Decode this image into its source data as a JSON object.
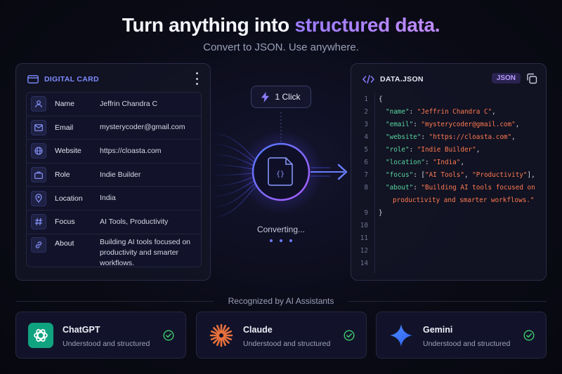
{
  "hero": {
    "title_plain": "Turn anything into ",
    "title_accent": "structured data.",
    "subtitle": "Convert to JSON. Use anywhere."
  },
  "card": {
    "header_label": "DIGITAL CARD",
    "fields": [
      {
        "icon": "user-icon",
        "label": "Name",
        "value": "Jeffrin Chandra C"
      },
      {
        "icon": "mail-icon",
        "label": "Email",
        "value": "mysterycoder@gmail.com"
      },
      {
        "icon": "globe-icon",
        "label": "Website",
        "value": "https://cloasta.com"
      },
      {
        "icon": "briefcase-icon",
        "label": "Role",
        "value": "Indie Builder"
      },
      {
        "icon": "location-pin-icon",
        "label": "Location",
        "value": "India"
      },
      {
        "icon": "hash-icon",
        "label": "Focus",
        "value": "AI Tools, Productivity"
      },
      {
        "icon": "link-icon",
        "label": "About",
        "value": "Building AI tools focused on productivity and smarter workflows."
      }
    ]
  },
  "center": {
    "pill_label": "1 Click",
    "status": "Converting..."
  },
  "json": {
    "header_label": "DATA.JSON",
    "badge": "JSON",
    "line_numbers": [
      "1",
      "2",
      "3",
      "4",
      "5",
      "6",
      "7",
      "8",
      "",
      "9",
      "10",
      "11",
      "12",
      "14"
    ],
    "lines": [
      "{",
      "\"name\": \"Jeffrin Chandra C\",",
      "\"email\": \"mysterycoder@gmail.com\",",
      "\"website\": \"https://cloasta.com\",",
      "\"role\": \"Indie Builder\",",
      "\"location\": \"India\",",
      "\"focus\": [\"AI Tools\", \"Productivity\"],",
      "\"about\": \"Building AI tools focused on",
      "productivity and smarter workflows.\"",
      "}"
    ]
  },
  "recognized": {
    "heading": "Recognized by AI Assistants",
    "assistants": [
      {
        "name": "ChatGPT",
        "desc": "Understood and structured",
        "icon": "chatgpt-logo-icon"
      },
      {
        "name": "Claude",
        "desc": "Understood and structured",
        "icon": "claude-logo-icon"
      },
      {
        "name": "Gemini",
        "desc": "Understood and structured",
        "icon": "gemini-logo-icon"
      }
    ]
  },
  "colors": {
    "accent": "#7d8cff",
    "json_key": "#59d6a0",
    "json_string": "#ff7a50",
    "check": "#3ecf6e"
  }
}
